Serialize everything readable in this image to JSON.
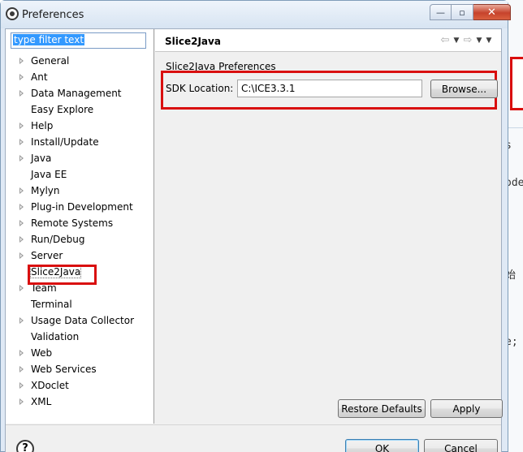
{
  "window": {
    "title": "Preferences",
    "caption_buttons": {
      "minimize": "—",
      "maximize": "▫",
      "close": "✕"
    }
  },
  "filter": {
    "placeholder": "type filter text",
    "value": "type filter text"
  },
  "tree": {
    "items": [
      {
        "label": "General",
        "expandable": true
      },
      {
        "label": "Ant",
        "expandable": true
      },
      {
        "label": "Data Management",
        "expandable": true
      },
      {
        "label": "Easy Explore",
        "expandable": false
      },
      {
        "label": "Help",
        "expandable": true
      },
      {
        "label": "Install/Update",
        "expandable": true
      },
      {
        "label": "Java",
        "expandable": true
      },
      {
        "label": "Java EE",
        "expandable": false
      },
      {
        "label": "Mylyn",
        "expandable": true
      },
      {
        "label": "Plug-in Development",
        "expandable": true
      },
      {
        "label": "Remote Systems",
        "expandable": true
      },
      {
        "label": "Run/Debug",
        "expandable": true
      },
      {
        "label": "Server",
        "expandable": true
      },
      {
        "label": "Slice2Java",
        "expandable": false,
        "selected": true
      },
      {
        "label": "Team",
        "expandable": true
      },
      {
        "label": "Terminal",
        "expandable": false
      },
      {
        "label": "Usage Data Collector",
        "expandable": true
      },
      {
        "label": "Validation",
        "expandable": false
      },
      {
        "label": "Web",
        "expandable": true
      },
      {
        "label": "Web Services",
        "expandable": true
      },
      {
        "label": "XDoclet",
        "expandable": true
      },
      {
        "label": "XML",
        "expandable": true
      }
    ]
  },
  "page": {
    "title": "Slice2Java",
    "section_label": "Slice2Java Preferences",
    "sdk_label": "SDK Location:",
    "sdk_value": "C:\\ICE3.3.1",
    "browse_label": "Browse...",
    "restore_defaults_label": "Restore Defaults",
    "apply_label": "Apply",
    "nav": {
      "back": "⇦",
      "forward": "⇨",
      "dropdown": "▼"
    }
  },
  "dialog": {
    "help_glyph": "?",
    "ok_label": "OK",
    "cancel_label": "Cancel"
  },
  "background_fragments": [
    "s",
    "ode",
    "始",
    "e;"
  ],
  "colors": {
    "highlight_red": "#d90f0f",
    "selection_blue": "#3399ff"
  }
}
